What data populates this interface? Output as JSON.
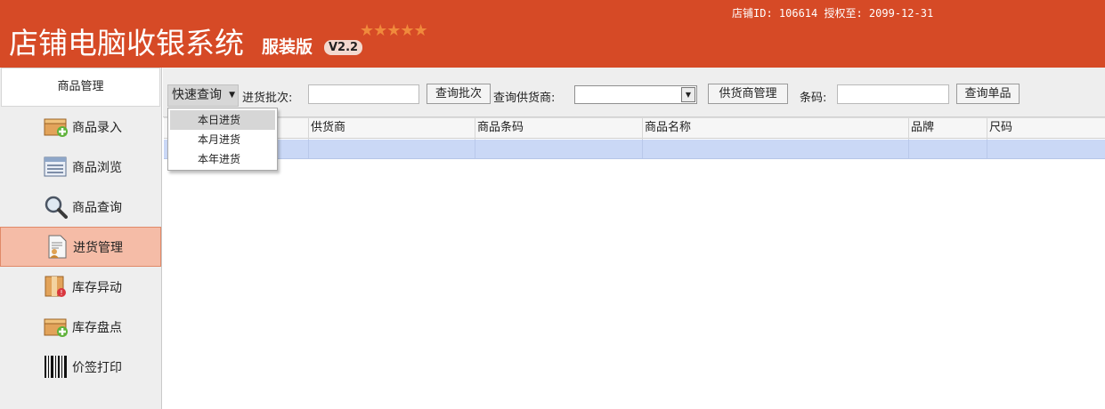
{
  "header": {
    "title": "店铺电脑收银系统",
    "edition": "服装版",
    "version": "V2.2",
    "stars": "★★★★★",
    "store_info": "店铺ID: 106614 授权至: 2099-12-31"
  },
  "colors": {
    "header_bg": "#d64a26",
    "active_item_bg": "#f5bca7",
    "selected_row": "#cad8f6"
  },
  "sidebar": {
    "heading": "商品管理",
    "items": [
      {
        "label": "商品录入",
        "icon": "box-add-icon"
      },
      {
        "label": "商品浏览",
        "icon": "list-icon"
      },
      {
        "label": "商品查询",
        "icon": "magnifier-icon"
      },
      {
        "label": "进货管理",
        "icon": "document-user-icon",
        "active": true
      },
      {
        "label": "库存异动",
        "icon": "box-alert-icon"
      },
      {
        "label": "库存盘点",
        "icon": "box-add-icon"
      },
      {
        "label": "价签打印",
        "icon": "barcode-icon"
      }
    ]
  },
  "toolbar": {
    "quick_query": "快速查询",
    "batch_label": "进货批次:",
    "batch_value": "",
    "batch_button": "查询批次",
    "supplier_label": "查询供货商:",
    "supplier_value": "",
    "supplier_button": "供货商管理",
    "barcode_label": "条码:",
    "barcode_value": "",
    "single_button": "查询单品"
  },
  "dropdown": {
    "items": [
      "本日进货",
      "本月进货",
      "本年进货"
    ],
    "highlighted": 0
  },
  "grid": {
    "columns": [
      "供货商",
      "商品条码",
      "商品名称",
      "品牌",
      "尺码"
    ]
  }
}
